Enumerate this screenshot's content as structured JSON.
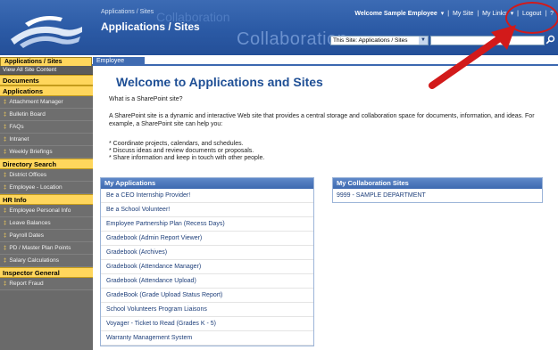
{
  "header": {
    "breadcrumb": "Applications / Sites",
    "title": "Applications / Sites",
    "watermark": "Collaboration",
    "watermark_top": "Collaboration",
    "welcome": "Welcome Sample Employee",
    "my_site": "My Site",
    "my_links": "My Links",
    "logout": "Logout",
    "help": "?",
    "scope_selected": "This Site: Applications / Sites",
    "search_placeholder": ""
  },
  "tabs": [
    {
      "label": "Applications / Sites"
    },
    {
      "label": "Employee Portal"
    }
  ],
  "sidebar": {
    "view_all": "View All Site Content",
    "sections": [
      {
        "heading": "Documents",
        "items": []
      },
      {
        "heading": "Applications",
        "items": [
          "Attachment Manager",
          "Bulletin Board",
          "FAQs",
          "Intranet",
          "Weekly Briefings"
        ]
      },
      {
        "heading": "Directory Search",
        "items": [
          "District Offices",
          "Employee - Location"
        ]
      },
      {
        "heading": "HR Info",
        "items": [
          "Employee Personal Info",
          "Leave Balances",
          "Payroll Dates",
          "PD / Master Plan Points",
          "Salary Calculations"
        ]
      },
      {
        "heading": "Inspector General",
        "items": [
          "Report Fraud"
        ]
      }
    ]
  },
  "main": {
    "title": "Welcome to Applications and Sites",
    "question": "What is a SharePoint site?",
    "description": "A SharePoint site is a dynamic and interactive Web site that provides a central storage and collaboration space for documents, information, and ideas. For example, a SharePoint site can help you:",
    "bullets": [
      "* Coordinate projects, calendars, and schedules.",
      "* Discuss ideas and review documents or proposals.",
      "* Share information and keep in touch with other people."
    ]
  },
  "my_applications": {
    "heading": "My Applications",
    "items": [
      "Be a CEO Internship Provider!",
      "Be a School Volunteer!",
      "Employee Partnership Plan (Recess Days)",
      "Gradebook (Admin Report Viewer)",
      "Gradebook (Archives)",
      "Gradebook (Attendance Manager)",
      "Gradebook (Attendance Upload)",
      "GradeBook (Grade Upload Status Report)",
      "School Volunteers Program Liaisons",
      "Voyager - Ticket to Read (Grades K - 5)",
      "Warranty Management System"
    ]
  },
  "my_collaboration_sites": {
    "heading": "My Collaboration Sites",
    "items": [
      "9999 - SAMPLE DEPARTMENT"
    ]
  },
  "colors": {
    "header_blue": "#2b5aa5",
    "accent_yellow": "#ffd65c",
    "title_blue": "#1f4f95",
    "highlight_red": "#d21a1a"
  }
}
